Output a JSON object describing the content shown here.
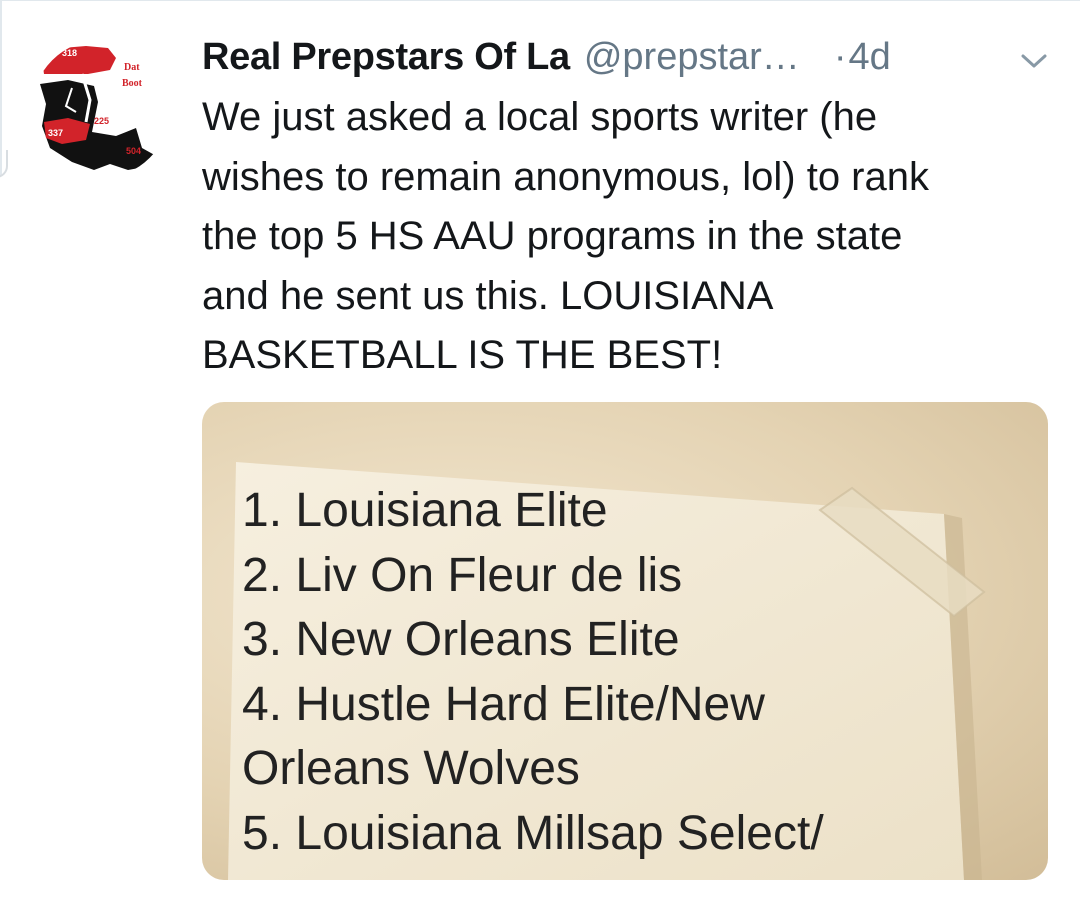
{
  "tweet": {
    "author_name": "Real Prepstars Of La",
    "handle": "@prepstar…",
    "separator": "·",
    "time": "4d",
    "text_lines": [
      "We just asked a local sports writer (he",
      "wishes to remain anonymous, lol) to rank",
      "the top 5 HS AAU programs in the state",
      "and he sent us this. LOUISIANA",
      "BASKETBALL IS THE BEST!"
    ]
  },
  "avatar": {
    "labels": [
      "318",
      "Dat",
      "Boot",
      "225",
      "337",
      "504"
    ],
    "colors": {
      "red": "#d2232a",
      "black": "#111111"
    }
  },
  "media": {
    "list_lines": [
      "1. Louisiana Elite",
      "2. Liv On Fleur de lis",
      "3. New Orleans Elite",
      "4. Hustle Hard Elite/New",
      "Orleans Wolves",
      "5. Louisiana Millsap Select/"
    ]
  },
  "icons": {
    "more": "chevron-down-icon"
  },
  "colors": {
    "text": "#14171a",
    "secondary": "#657786",
    "divider": "#e1e8ed"
  }
}
